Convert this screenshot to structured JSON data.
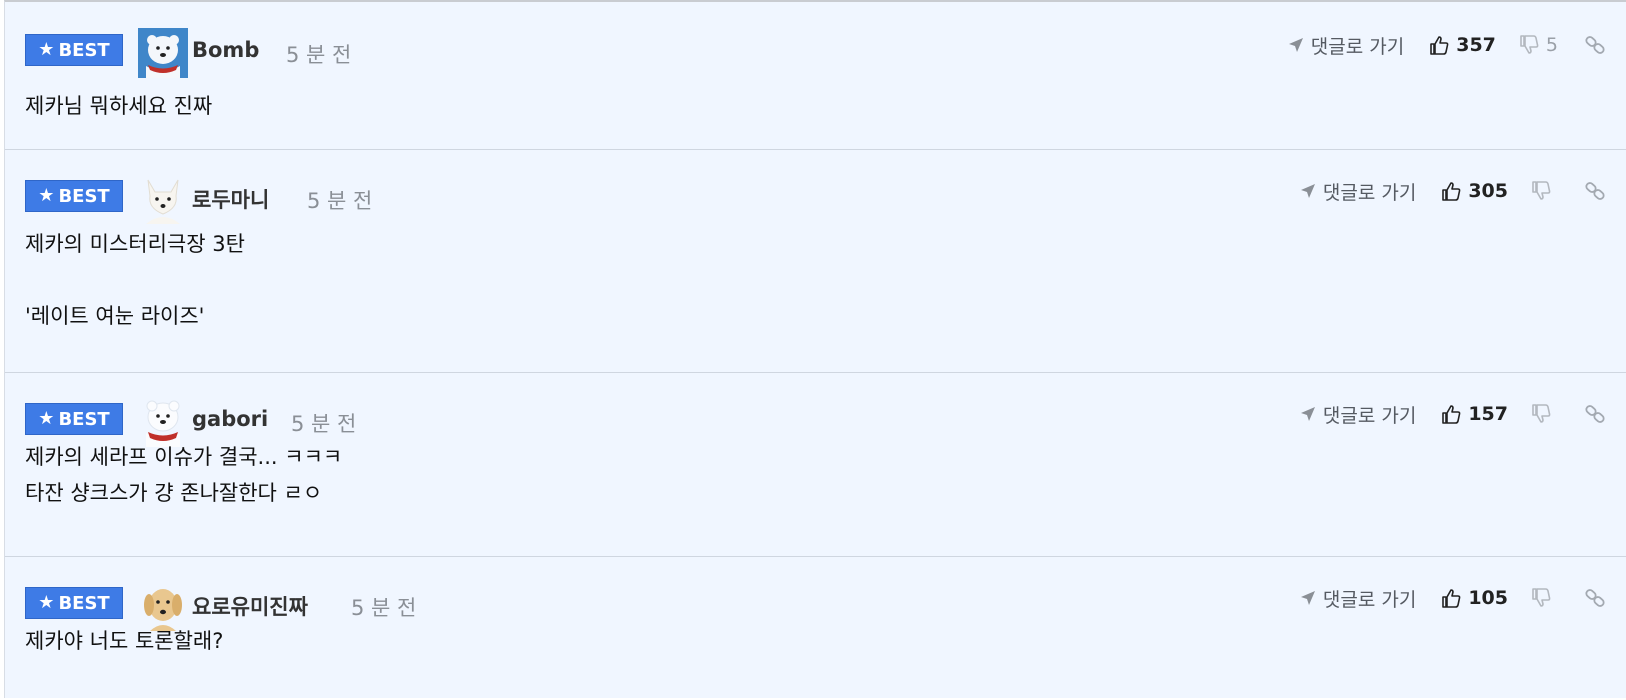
{
  "comments": [
    {
      "badge": "BEST",
      "nickname": "Bomb",
      "time": "5 분 전",
      "body": "제카님 뭐하세요 진짜",
      "goto_label": "댓글로 가기",
      "likes": "357",
      "dislikes": "5",
      "avatar": "polar-bear"
    },
    {
      "badge": "BEST",
      "nickname": "로두마니",
      "time": "5 분 전",
      "body": "제카의 미스터리극장 3탄\n\n'레이트 여눈 라이즈'",
      "goto_label": "댓글로 가기",
      "likes": "305",
      "dislikes": "",
      "avatar": "arctic-fox"
    },
    {
      "badge": "BEST",
      "nickname": "gabori",
      "time": "5 분 전",
      "body": "제카의 세라프 이슈가 결국... ㅋㅋㅋ\n타잔 샹크스가 걍 존나잘한다 ㄹㅇ",
      "goto_label": "댓글로 가기",
      "likes": "157",
      "dislikes": "",
      "avatar": "polar-bear"
    },
    {
      "badge": "BEST",
      "nickname": "요로유미진짜",
      "time": "5 분 전",
      "body": "제카야 너도 토론할래?",
      "goto_label": "댓글로 가기",
      "likes": "105",
      "dislikes": "",
      "avatar": "puppy"
    }
  ],
  "colors": {
    "background": "#f0f6ff",
    "best_badge": "#3e7be6",
    "nickname": "#333333",
    "time": "#8a8f96"
  },
  "icons": [
    "star-icon",
    "send-icon",
    "thumbs-up-icon",
    "thumbs-down-icon",
    "link-icon"
  ]
}
